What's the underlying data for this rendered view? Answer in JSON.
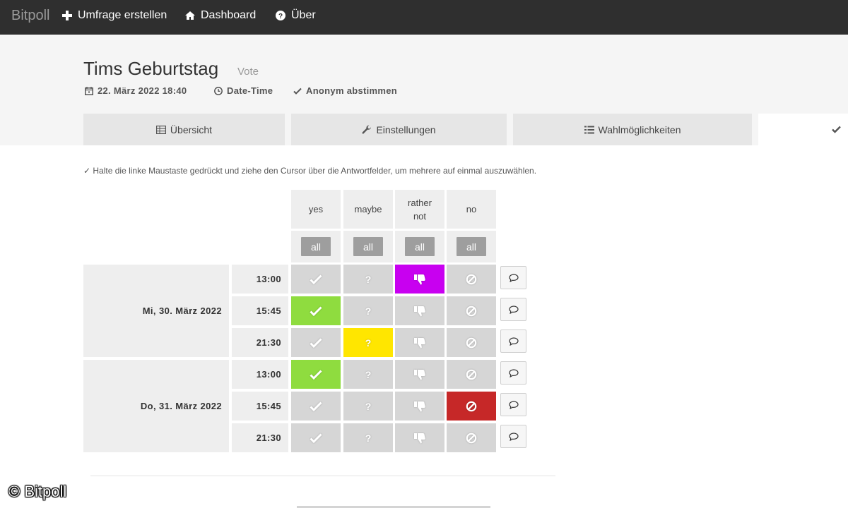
{
  "navbar": {
    "brand": "Bitpoll",
    "items": [
      {
        "label": "Umfrage erstellen",
        "icon": "plus-icon"
      },
      {
        "label": "Dashboard",
        "icon": "home-icon"
      },
      {
        "label": "Über",
        "icon": "question-circle-icon"
      }
    ]
  },
  "poll": {
    "title": "Tims Geburtstag",
    "type": "Vote",
    "date": "22. März 2022 18:40",
    "kind": "Date-Time",
    "anonymous": "Anonym abstimmen"
  },
  "tabs": [
    {
      "label": "Übersicht",
      "icon": "table-icon"
    },
    {
      "label": "Einstellungen",
      "icon": "wrench-icon"
    },
    {
      "label": "Wahlmöglichkeiten",
      "icon": "list-icon"
    },
    {
      "label": "",
      "icon": "check-icon",
      "active": true
    }
  ],
  "hint": "✓ Halte die linke Maustaste gedrückt und ziehe den Cursor über die Antwortfelder, um mehrere auf einmal auszuwählen.",
  "answers": {
    "yes": "yes",
    "maybe": "maybe",
    "rather_not_line1": "rather",
    "rather_not_line2": "not",
    "no": "no",
    "all_label": "all"
  },
  "colors": {
    "yes": "#8fdc3f",
    "maybe": "#ffe600",
    "rather_not": "#c800f0",
    "no": "#c62828",
    "unselected": "#d6d6d6"
  },
  "dates": [
    {
      "label": "Mi, 30. März 2022",
      "times": [
        {
          "time": "13:00",
          "selected": "rather_not"
        },
        {
          "time": "15:45",
          "selected": "yes"
        },
        {
          "time": "21:30",
          "selected": "maybe"
        }
      ]
    },
    {
      "label": "Do, 31. März 2022",
      "times": [
        {
          "time": "13:00",
          "selected": "yes"
        },
        {
          "time": "15:45",
          "selected": "no"
        },
        {
          "time": "21:30",
          "selected": null
        }
      ]
    }
  ],
  "watermark": "© Bitpoll"
}
